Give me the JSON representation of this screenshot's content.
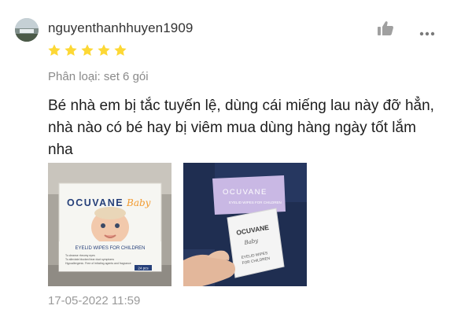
{
  "review": {
    "username": "nguyenthanhhuyen1909",
    "rating": 5,
    "rating_max": 5,
    "variant_label": "Phân loại: set 6 gói",
    "comment": "Bé nhà em bị tắc tuyến lệ, dùng cái miếng lau này đỡ hẳn, nhà nào có bé hay bị viêm mua dùng hàng ngày tốt lắm nha",
    "date": "17-05-2022 11:59"
  },
  "icons": {
    "like": "thumbs-up-icon",
    "more": "more-dots-icon",
    "star": "star-icon"
  },
  "colors": {
    "star": "#fdd835",
    "icon_gray": "#9e9e9e",
    "meta_text": "#8a8a8a"
  },
  "photos": [
    {
      "brand": "OCUVANE",
      "brand_suffix": "Baby",
      "product_line": "EYELID WIPES FOR CHILDREN",
      "bullets": [
        "To cleanse rheumy eyes",
        "To alleviate blocked tear duct symptoms",
        "Hypoallergenic. Free of irritating agents and fragrance"
      ],
      "count": "24 pcs"
    },
    {
      "brand": "OCUVANE",
      "brand_suffix": "Baby",
      "box_subtitle": "EYELID WIPES FOR CHILDREN",
      "sachet_line1": "EYELID WIPES",
      "sachet_line2": "FOR CHILDREN"
    }
  ]
}
